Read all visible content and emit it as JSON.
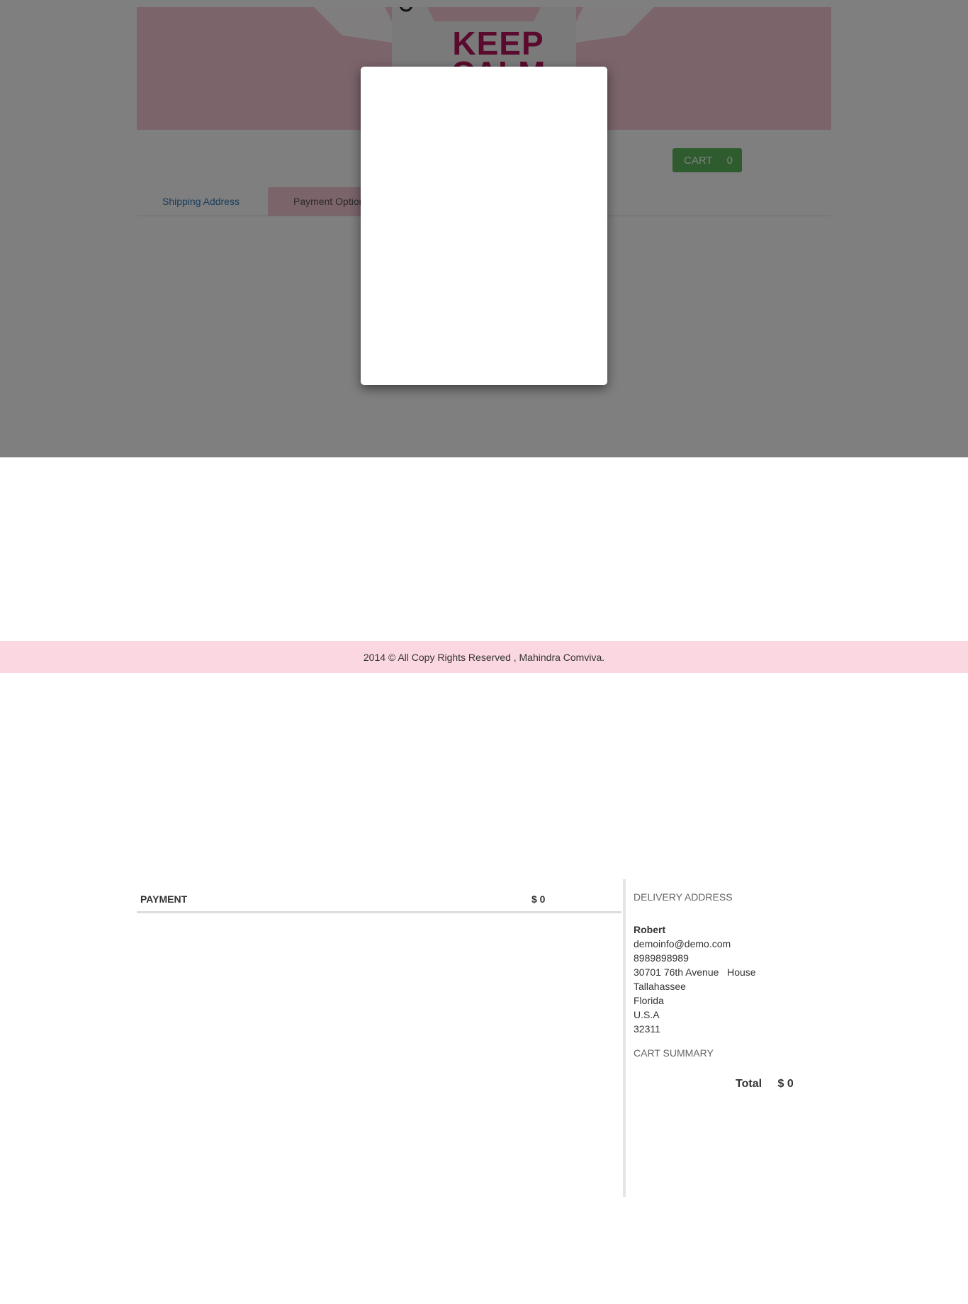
{
  "banner": {
    "line1": "KEEP",
    "line2": "CALM",
    "brand_color": "#b5145a",
    "background_color": "#f7c8d4"
  },
  "cart": {
    "label": "CART",
    "count": "0",
    "color": "#5cb85c"
  },
  "tabs": [
    {
      "label": "Shipping Address"
    },
    {
      "label": "Payment Option"
    }
  ],
  "footer": {
    "text": "2014 © All Copy Rights Reserved , Mahindra Comviva."
  },
  "payment": {
    "label": "PAYMENT",
    "amount": "$ 0"
  },
  "delivery": {
    "title": "DELIVERY ADDRESS",
    "name": "Robert",
    "email": "demoinfo@demo.com",
    "phone": "8989898989",
    "street": "30701 76th Avenue   House",
    "city": "Tallahassee",
    "state": "Florida",
    "country": "U.S.A",
    "zip": "32311"
  },
  "cart_summary": {
    "title": "CART SUMMARY",
    "total_label": "Total",
    "total_value": "$ 0"
  }
}
